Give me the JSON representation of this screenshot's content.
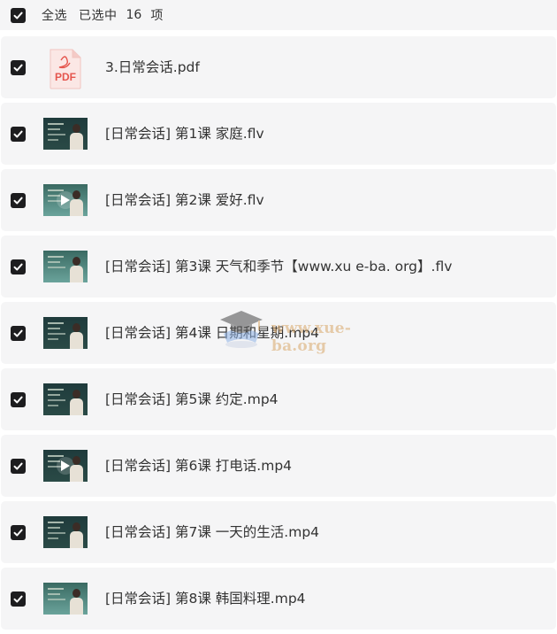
{
  "header": {
    "select_all_label": "全选",
    "selected_label": "已选中",
    "selected_count": "16",
    "selected_unit": "项"
  },
  "files": [
    {
      "name": "3.日常会话.pdf",
      "type": "pdf",
      "checked": true
    },
    {
      "name": "[日常会话] 第1课 家庭.flv",
      "type": "video",
      "checked": true
    },
    {
      "name": "[日常会话] 第2课 爱好.flv",
      "type": "video",
      "checked": true
    },
    {
      "name": "[日常会话] 第3课 天气和季节【www.xu e-ba. org】.flv",
      "type": "video",
      "checked": true
    },
    {
      "name": "[日常会话] 第4课 日期和星期.mp4",
      "type": "video",
      "checked": true
    },
    {
      "name": "[日常会话] 第5课 约定.mp4",
      "type": "video",
      "checked": true
    },
    {
      "name": "[日常会话] 第6课 打电话.mp4",
      "type": "video",
      "checked": true
    },
    {
      "name": "[日常会话] 第7课 一天的生活.mp4",
      "type": "video",
      "checked": true
    },
    {
      "name": "[日常会话] 第8课 韩国料理.mp4",
      "type": "video",
      "checked": true
    }
  ],
  "pdf_icon_label": "PDF",
  "watermark": {
    "text": "www.xue-ba.org"
  },
  "colors": {
    "row_background": "#f5f5f6",
    "checkbox_fill": "#1d1d1f",
    "pdf_red": "#e5564e",
    "text": "#333333"
  }
}
